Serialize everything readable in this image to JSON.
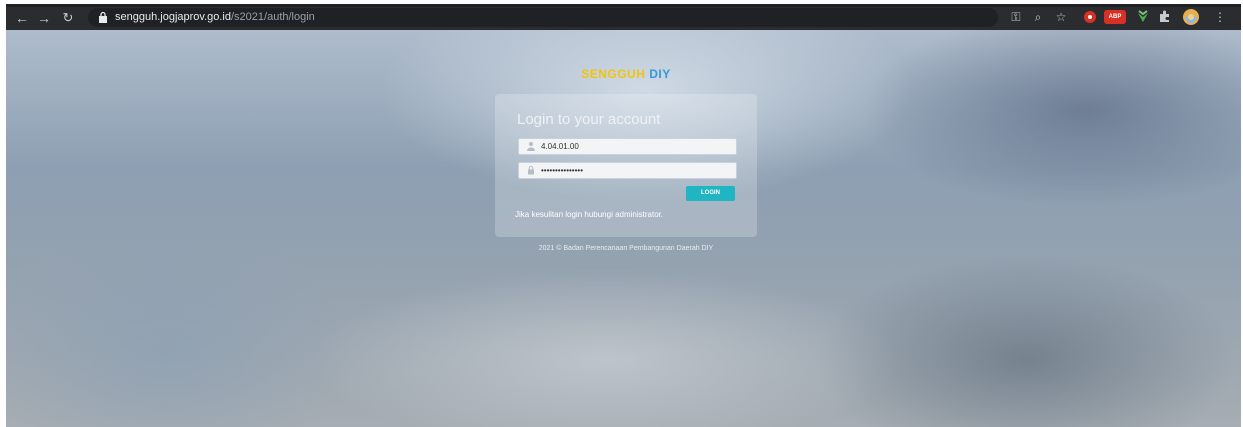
{
  "browser": {
    "url_host": "sengguh.jogjaprov.go.id",
    "url_path": "/s2021/auth/login",
    "extensions": [
      "key-icon",
      "zoom-icon",
      "star-icon",
      "red-ext-icon",
      "abp-icon",
      "green-ext-icon",
      "puzzle-icon",
      "avatar",
      "menu-icon"
    ],
    "abp_label": "ABP"
  },
  "page": {
    "brand_part1": "SENGGUH",
    "brand_part2": "DIY",
    "login_title": "Login to your account",
    "username_value": "4.04.01.00",
    "password_value": "•••••••••••••••",
    "login_button": "LOGIN",
    "help_text": "Jika kesulitan login hubungi administrator.",
    "footer": "2021 © Badan Perencanaan Pembangunan Daerah DIY"
  },
  "colors": {
    "brand_yellow": "#f1c40f",
    "brand_blue": "#3498db",
    "button": "#1fb5c2"
  }
}
